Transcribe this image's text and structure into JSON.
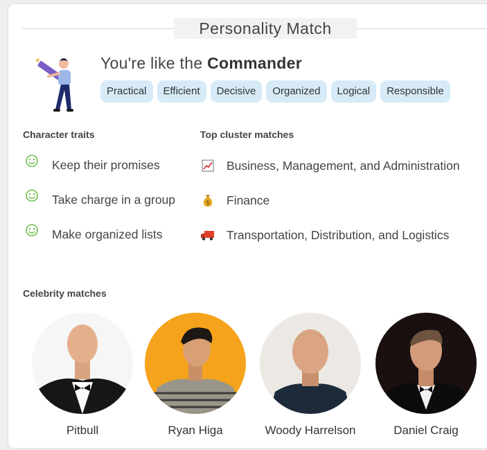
{
  "header": {
    "title": "Personality Match"
  },
  "match": {
    "prefix": "You're like the ",
    "type_name": "Commander",
    "tags": [
      "Practical",
      "Efficient",
      "Decisive",
      "Organized",
      "Logical",
      "Responsible"
    ]
  },
  "traits": {
    "label": "Character traits",
    "items": [
      {
        "text": "Keep their promises",
        "icon": "smiley-icon"
      },
      {
        "text": "Take charge in a group",
        "icon": "smiley-icon"
      },
      {
        "text": "Make organized lists",
        "icon": "smiley-icon"
      }
    ]
  },
  "clusters": {
    "label": "Top cluster matches",
    "items": [
      {
        "text": "Business, Management, and Administration",
        "icon": "chart-icon"
      },
      {
        "text": "Finance",
        "icon": "money-bag-icon"
      },
      {
        "text": "Transportation, Distribution, and Logistics",
        "icon": "truck-icon"
      }
    ]
  },
  "celebrities": {
    "label": "Celebrity matches",
    "items": [
      {
        "name": "Pitbull"
      },
      {
        "name": "Ryan Higa"
      },
      {
        "name": "Woody Harrelson"
      },
      {
        "name": "Daniel Craig"
      }
    ]
  },
  "colors": {
    "tag_bg": "#d6ebf7",
    "smiley_green": "#6cc04a",
    "title_bg": "#f2f2f2"
  }
}
